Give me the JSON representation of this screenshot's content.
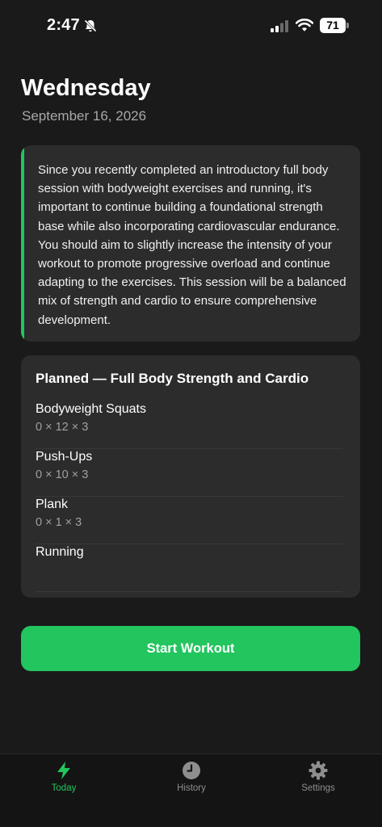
{
  "status_bar": {
    "time": "2:47",
    "battery": "71"
  },
  "header": {
    "title": "Wednesday",
    "date": "September 16, 2026"
  },
  "note": {
    "text": "Since you recently completed an introductory full body session with bodyweight exercises and running, it's important to continue building a foundational strength base while also incorporating cardiovascular endurance. You should aim to slightly increase the intensity of your workout to promote progressive overload and continue adapting to the exercises. This session will be a balanced mix of strength and cardio to ensure comprehensive development.",
    "accent_color": "#22c55e"
  },
  "plan": {
    "title": "Planned — Full Body Strength and Cardio",
    "exercises": [
      {
        "name": "Bodyweight Squats",
        "detail": "0 × 12 × 3"
      },
      {
        "name": "Push-Ups",
        "detail": "0 × 10 × 3"
      },
      {
        "name": "Plank",
        "detail": "0 × 1 × 3"
      },
      {
        "name": "Running",
        "detail": ""
      }
    ]
  },
  "actions": {
    "start_label": "Start Workout",
    "start_color": "#22c55e"
  },
  "tabs": [
    {
      "label": "Today",
      "icon": "bolt-icon",
      "active": true,
      "color": "#22c55e"
    },
    {
      "label": "History",
      "icon": "clock-icon",
      "active": false,
      "color": "#8e8e8e"
    },
    {
      "label": "Settings",
      "icon": "gear-icon",
      "active": false,
      "color": "#8e8e8e"
    }
  ]
}
